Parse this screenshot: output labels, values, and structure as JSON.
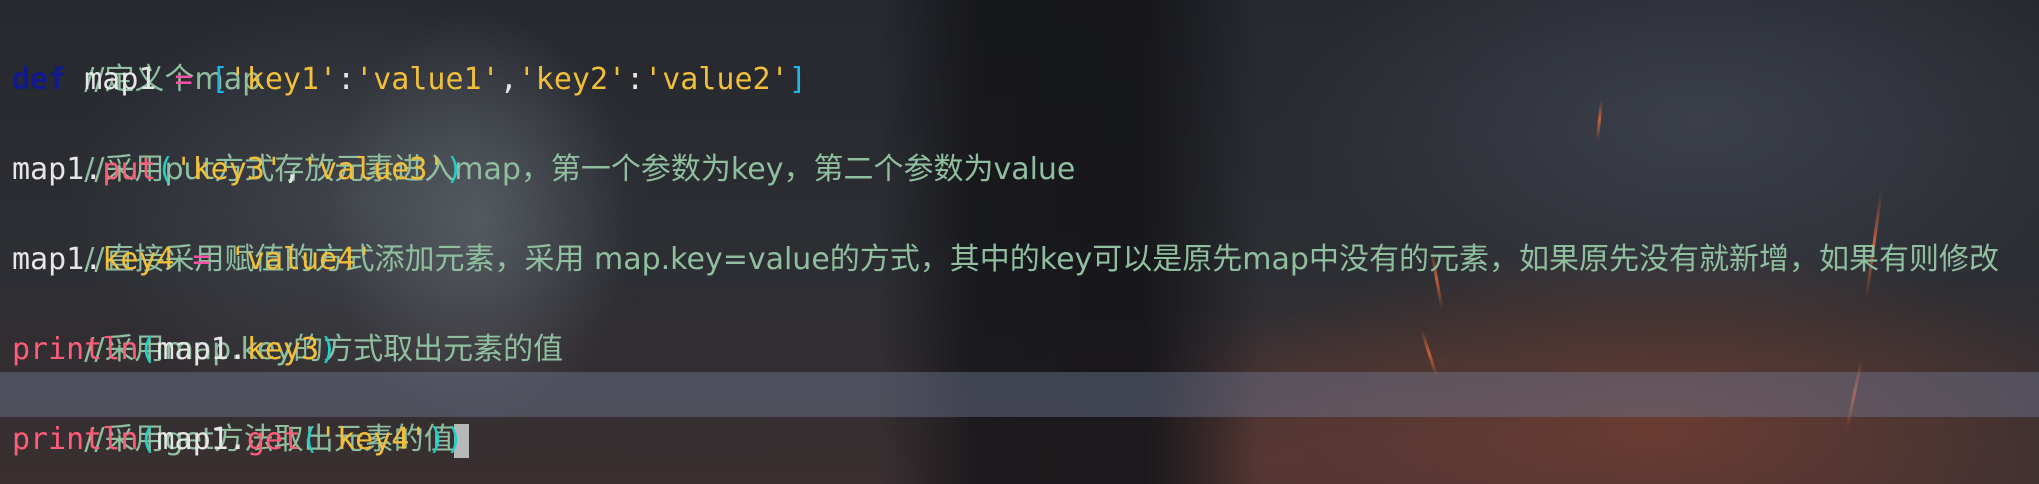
{
  "editor": {
    "lines": [
      {
        "comment": "//定义个map"
      },
      {
        "kw": "def",
        "var": " map1 ",
        "op": "=",
        "open": " [",
        "k1": "'key1'",
        "colon1": ":",
        "v1": "'value1'",
        "comma": ",",
        "k2": "'key2'",
        "colon2": ":",
        "v2": "'value2'",
        "close": "]"
      },
      {
        "comment": "//采用put方式存放元素进入map，第一个参数为key，第二个参数为value"
      },
      {
        "obj": "map1",
        "dot": ".",
        "method": "put",
        "open": "(",
        "a1": "'key3'",
        "comma": ",",
        "a2": "'value3'",
        "close": ")"
      },
      {
        "comment": "//直接采用赋值的方式添加元素，采用 map.key=value的方式，其中的key可以是原先map中没有的元素，如果原先没有就新增，如果有则修改"
      },
      {
        "obj": "map1",
        "dot": ".",
        "prop": "key4",
        "op": " = ",
        "val": "'value4'"
      },
      {
        "comment": "//采用map.key的方式取出元素的值"
      },
      {
        "fn": "println",
        "open": "(",
        "obj": "map1",
        "dot": ".",
        "prop": "key3",
        "close": ")"
      },
      {
        "comment": "//采用get方法取出元素的值"
      },
      {
        "fn": "println",
        "open": "(",
        "obj": "map1",
        "dot": ".",
        "method": "get",
        "open2": "(",
        "arg": "'key4'",
        "close": "))"
      }
    ]
  },
  "colors": {
    "comment": "#8fbf9f",
    "keyword": "#101a8a",
    "operator": "#ff4fa8",
    "string": "#f2bf39",
    "function": "#ff5c77",
    "current_line": "#6e7891"
  }
}
